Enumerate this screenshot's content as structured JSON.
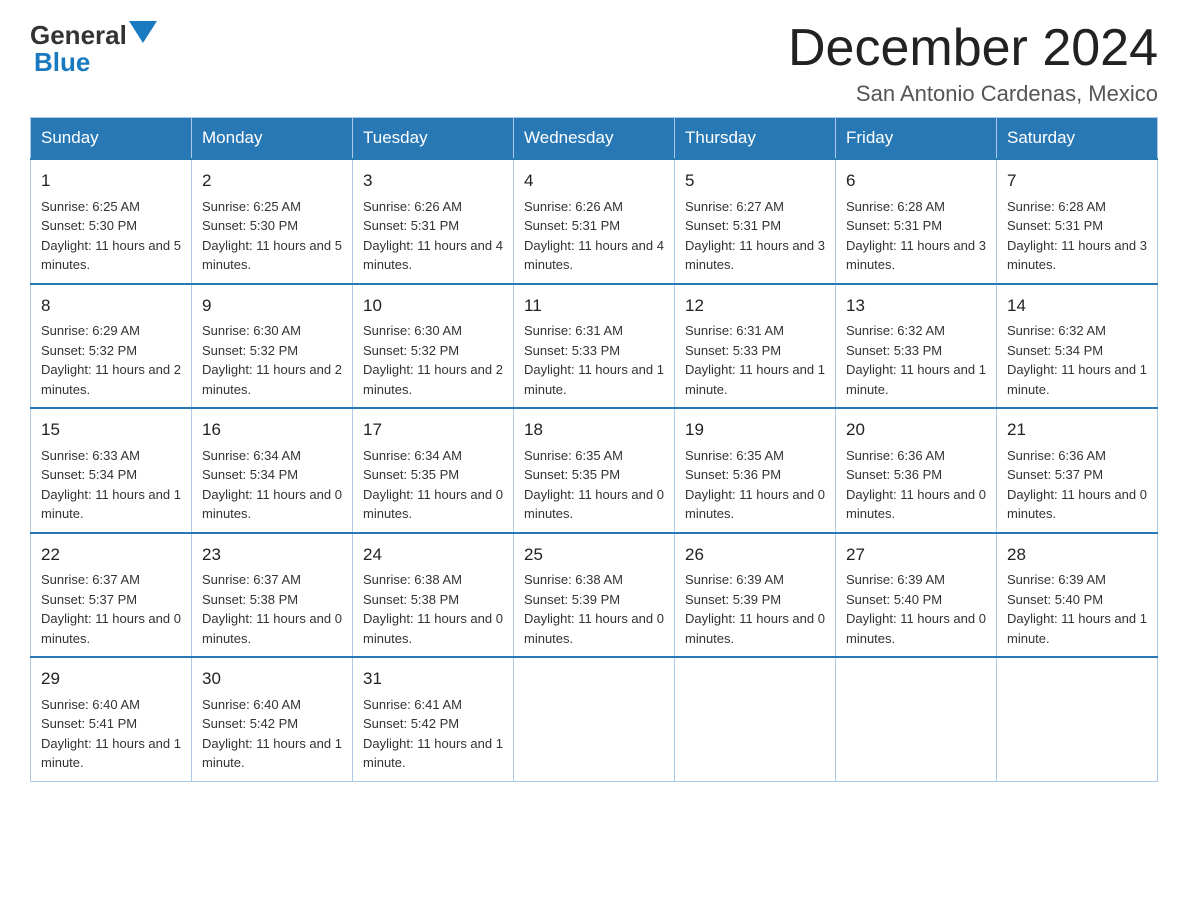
{
  "logo": {
    "text_general": "General",
    "text_blue": "Blue"
  },
  "title": {
    "month": "December 2024",
    "location": "San Antonio Cardenas, Mexico"
  },
  "days_of_week": [
    "Sunday",
    "Monday",
    "Tuesday",
    "Wednesday",
    "Thursday",
    "Friday",
    "Saturday"
  ],
  "weeks": [
    [
      {
        "day": "1",
        "sunrise": "6:25 AM",
        "sunset": "5:30 PM",
        "daylight": "11 hours and 5 minutes."
      },
      {
        "day": "2",
        "sunrise": "6:25 AM",
        "sunset": "5:30 PM",
        "daylight": "11 hours and 5 minutes."
      },
      {
        "day": "3",
        "sunrise": "6:26 AM",
        "sunset": "5:31 PM",
        "daylight": "11 hours and 4 minutes."
      },
      {
        "day": "4",
        "sunrise": "6:26 AM",
        "sunset": "5:31 PM",
        "daylight": "11 hours and 4 minutes."
      },
      {
        "day": "5",
        "sunrise": "6:27 AM",
        "sunset": "5:31 PM",
        "daylight": "11 hours and 3 minutes."
      },
      {
        "day": "6",
        "sunrise": "6:28 AM",
        "sunset": "5:31 PM",
        "daylight": "11 hours and 3 minutes."
      },
      {
        "day": "7",
        "sunrise": "6:28 AM",
        "sunset": "5:31 PM",
        "daylight": "11 hours and 3 minutes."
      }
    ],
    [
      {
        "day": "8",
        "sunrise": "6:29 AM",
        "sunset": "5:32 PM",
        "daylight": "11 hours and 2 minutes."
      },
      {
        "day": "9",
        "sunrise": "6:30 AM",
        "sunset": "5:32 PM",
        "daylight": "11 hours and 2 minutes."
      },
      {
        "day": "10",
        "sunrise": "6:30 AM",
        "sunset": "5:32 PM",
        "daylight": "11 hours and 2 minutes."
      },
      {
        "day": "11",
        "sunrise": "6:31 AM",
        "sunset": "5:33 PM",
        "daylight": "11 hours and 1 minute."
      },
      {
        "day": "12",
        "sunrise": "6:31 AM",
        "sunset": "5:33 PM",
        "daylight": "11 hours and 1 minute."
      },
      {
        "day": "13",
        "sunrise": "6:32 AM",
        "sunset": "5:33 PM",
        "daylight": "11 hours and 1 minute."
      },
      {
        "day": "14",
        "sunrise": "6:32 AM",
        "sunset": "5:34 PM",
        "daylight": "11 hours and 1 minute."
      }
    ],
    [
      {
        "day": "15",
        "sunrise": "6:33 AM",
        "sunset": "5:34 PM",
        "daylight": "11 hours and 1 minute."
      },
      {
        "day": "16",
        "sunrise": "6:34 AM",
        "sunset": "5:34 PM",
        "daylight": "11 hours and 0 minutes."
      },
      {
        "day": "17",
        "sunrise": "6:34 AM",
        "sunset": "5:35 PM",
        "daylight": "11 hours and 0 minutes."
      },
      {
        "day": "18",
        "sunrise": "6:35 AM",
        "sunset": "5:35 PM",
        "daylight": "11 hours and 0 minutes."
      },
      {
        "day": "19",
        "sunrise": "6:35 AM",
        "sunset": "5:36 PM",
        "daylight": "11 hours and 0 minutes."
      },
      {
        "day": "20",
        "sunrise": "6:36 AM",
        "sunset": "5:36 PM",
        "daylight": "11 hours and 0 minutes."
      },
      {
        "day": "21",
        "sunrise": "6:36 AM",
        "sunset": "5:37 PM",
        "daylight": "11 hours and 0 minutes."
      }
    ],
    [
      {
        "day": "22",
        "sunrise": "6:37 AM",
        "sunset": "5:37 PM",
        "daylight": "11 hours and 0 minutes."
      },
      {
        "day": "23",
        "sunrise": "6:37 AM",
        "sunset": "5:38 PM",
        "daylight": "11 hours and 0 minutes."
      },
      {
        "day": "24",
        "sunrise": "6:38 AM",
        "sunset": "5:38 PM",
        "daylight": "11 hours and 0 minutes."
      },
      {
        "day": "25",
        "sunrise": "6:38 AM",
        "sunset": "5:39 PM",
        "daylight": "11 hours and 0 minutes."
      },
      {
        "day": "26",
        "sunrise": "6:39 AM",
        "sunset": "5:39 PM",
        "daylight": "11 hours and 0 minutes."
      },
      {
        "day": "27",
        "sunrise": "6:39 AM",
        "sunset": "5:40 PM",
        "daylight": "11 hours and 0 minutes."
      },
      {
        "day": "28",
        "sunrise": "6:39 AM",
        "sunset": "5:40 PM",
        "daylight": "11 hours and 1 minute."
      }
    ],
    [
      {
        "day": "29",
        "sunrise": "6:40 AM",
        "sunset": "5:41 PM",
        "daylight": "11 hours and 1 minute."
      },
      {
        "day": "30",
        "sunrise": "6:40 AM",
        "sunset": "5:42 PM",
        "daylight": "11 hours and 1 minute."
      },
      {
        "day": "31",
        "sunrise": "6:41 AM",
        "sunset": "5:42 PM",
        "daylight": "11 hours and 1 minute."
      },
      null,
      null,
      null,
      null
    ]
  ],
  "labels": {
    "sunrise": "Sunrise:",
    "sunset": "Sunset:",
    "daylight": "Daylight:"
  }
}
